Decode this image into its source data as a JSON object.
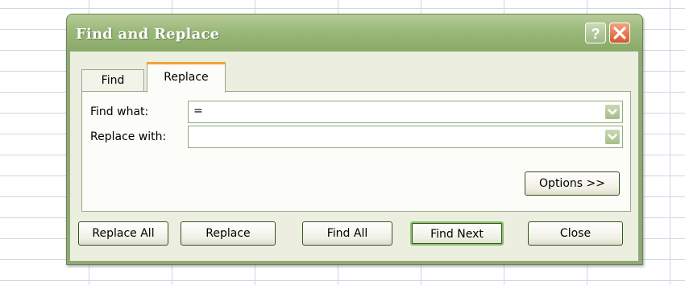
{
  "dialog": {
    "title": "Find and Replace",
    "help_icon": "question-mark-icon",
    "close_icon": "close-x-icon"
  },
  "tabs": [
    {
      "label": "Find",
      "selected": false
    },
    {
      "label": "Replace",
      "selected": true
    }
  ],
  "fields": {
    "find_what": {
      "label": "Find what:",
      "value": "="
    },
    "replace_with": {
      "label": "Replace with:",
      "value": ""
    },
    "dropdown_icon": "chevron-down-icon"
  },
  "buttons": {
    "options": "Options >>",
    "replace_all": "Replace All",
    "replace": "Replace",
    "find_all": "Find All",
    "find_next": "Find Next",
    "close": "Close"
  },
  "colors": {
    "accent_tab": "#f2a33a",
    "title_bar": "#9ab87a",
    "close_button": "#d9572f"
  }
}
